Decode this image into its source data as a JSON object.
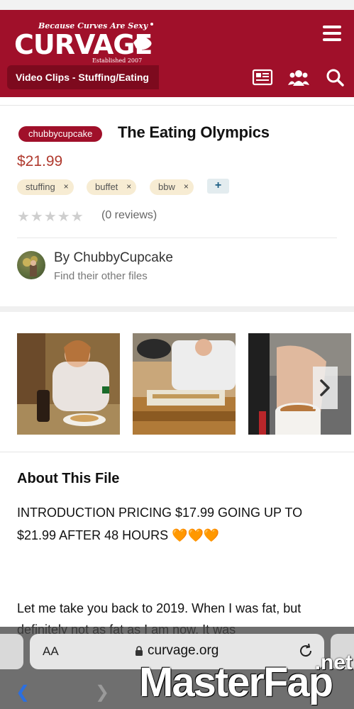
{
  "header": {
    "logo": {
      "tagline": "Because Curves Are Sexy",
      "brand": "CURVAGE",
      "established": "Established 2007"
    },
    "breadcrumb": "Video Clips - Stuffing/Eating",
    "icons": [
      "menu-icon",
      "newspaper-icon",
      "users-icon",
      "search-icon"
    ],
    "brand_color": "#a0102a"
  },
  "product": {
    "seller_badge": "chubbycupcake",
    "title": "The Eating Olympics",
    "price": "$21.99",
    "price_color": "#b03a2e",
    "tags": [
      {
        "label": "stuffing",
        "remove": "×"
      },
      {
        "label": "buffet",
        "remove": "×"
      },
      {
        "label": "bbw",
        "remove": "×"
      }
    ],
    "add_tag": "+",
    "rating": {
      "stars": "★★★★★",
      "value": 0,
      "max": 5,
      "reviews": "(0 reviews)"
    },
    "author": {
      "by": "By ChubbyCupcake",
      "link": "Find their other files"
    }
  },
  "gallery": {
    "next": "chevron-right-icon"
  },
  "about": {
    "title": "About This File",
    "paragraph1": "INTRODUCTION PRICING $17.99 GOING UP TO $21.99 AFTER 48 HOURS 🧡🧡🧡",
    "paragraph2": "Let me take you back to 2019. When I was fat, but definitely not as fat as I am now. It was"
  },
  "browser": {
    "text_size": "AA",
    "url": "curvage.org",
    "watermark": "MasterFap",
    "watermark_suffix": ".net"
  }
}
